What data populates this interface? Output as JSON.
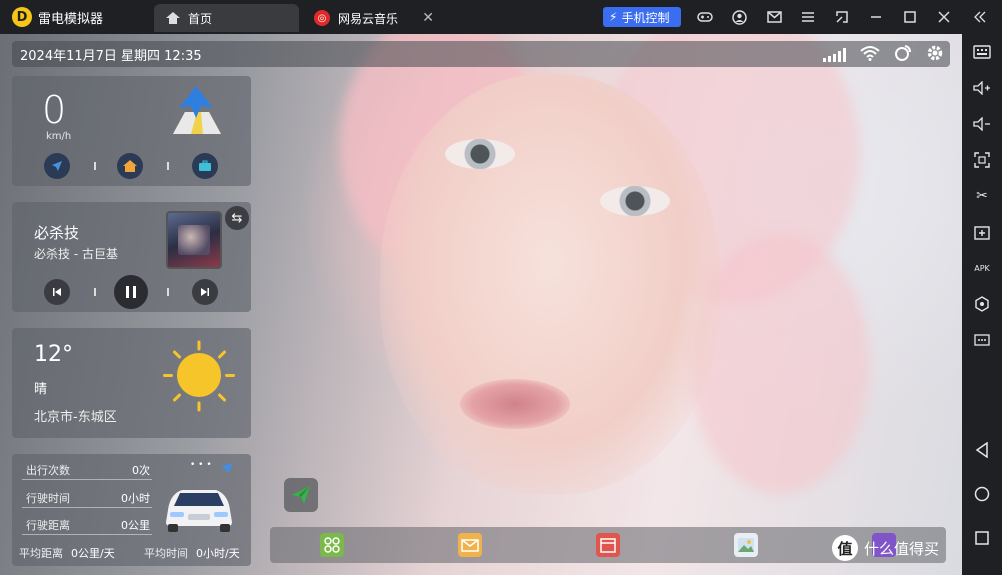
{
  "titlebar": {
    "app_name": "雷电模拟器",
    "tabs": [
      {
        "label": "首页",
        "icon": "home-icon"
      },
      {
        "label": "网易云音乐",
        "icon": "netease-music-icon"
      }
    ],
    "hand_control_label": "手机控制",
    "right_icons": [
      "gamepad-icon",
      "user-icon",
      "mail-icon",
      "menu-icon",
      "fullscreen-toggle-icon",
      "minimize-icon",
      "maximize-icon",
      "close-icon",
      "collapse-icon"
    ]
  },
  "statusbar": {
    "datetime": "2024年11月7日  星期四  12:35",
    "icons": [
      "signal-icon",
      "wifi-icon",
      "location-signal-icon",
      "settings-icon"
    ]
  },
  "nav_widget": {
    "speed": "0",
    "unit": "km/h",
    "buttons": [
      "navigate-icon",
      "home-icon",
      "work-briefcase-icon"
    ]
  },
  "music_widget": {
    "title": "必杀技",
    "subtitle": "必杀技 - 古巨基",
    "buttons": [
      "previous-icon",
      "pause-icon",
      "next-icon"
    ]
  },
  "weather_widget": {
    "temperature": "12°",
    "condition": "晴",
    "city": "北京市-东城区"
  },
  "trip_widget": {
    "rows": [
      {
        "label": "出行次数",
        "value": "0次"
      },
      {
        "label": "行驶时间",
        "value": "0小时"
      },
      {
        "label": "行驶距离",
        "value": "0公里"
      }
    ],
    "avg_distance_label": "平均距离",
    "avg_distance_value": "0公里/天",
    "avg_time_label": "平均时间",
    "avg_time_value": "0小时/天",
    "menu_dots": "• • •"
  },
  "dock": {
    "apps": [
      "app-grid-icon",
      "mail-app-icon",
      "calendar-app-icon",
      "gallery-app-icon",
      "purple-app-icon"
    ]
  },
  "watermark": {
    "logo_char": "值",
    "text": "什么值得买"
  },
  "colors": {
    "accent_blue": "#3a6df0",
    "titlebar_bg": "#1f2023",
    "widget_bg": "#5f626a",
    "sun": "#f5c52a"
  }
}
